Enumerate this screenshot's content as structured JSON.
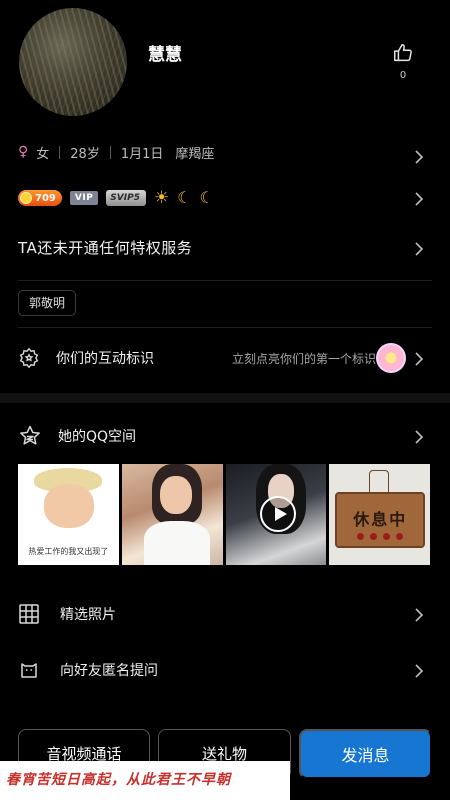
{
  "profile": {
    "nickname": "慧慧",
    "like_count": "0"
  },
  "info": {
    "gender": "女",
    "age": "28岁",
    "birthday": "1月1日",
    "zodiac": "摩羯座"
  },
  "badges": {
    "level": "709",
    "vip": "VIP",
    "svip": "SVIP5"
  },
  "privilege_text": "TA还未开通任何特权服务",
  "tag_label": "郭敬明",
  "interaction": {
    "title": "你们的互动标识",
    "hint": "立刻点亮你们的第一个标识"
  },
  "qzone": {
    "title": "她的QQ空间",
    "photo1_caption": "热爱工作的我又出现了",
    "photo4_sign": "休息中"
  },
  "menu": {
    "photos": "精选照片",
    "anonymous_ask": "向好友匿名提问"
  },
  "actions": {
    "call": "音视频通话",
    "gift": "送礼物",
    "message": "发消息"
  },
  "overlay_text": "春宵苦短日高起，从此君王不早朝",
  "colors": {
    "primary_button": "#1776d2",
    "background": "#000000",
    "overlay_text": "#c8302c"
  }
}
